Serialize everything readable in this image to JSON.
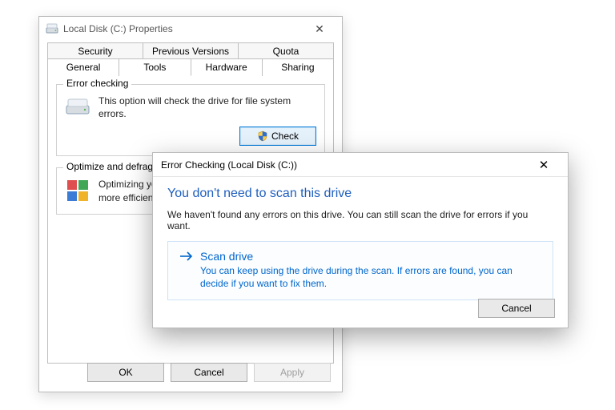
{
  "propWindow": {
    "title": "Local Disk (C:) Properties",
    "tabsBack": [
      "Security",
      "Previous Versions",
      "Quota"
    ],
    "tabsFront": [
      "General",
      "Tools",
      "Hardware",
      "Sharing"
    ],
    "activeTab": "Tools",
    "errorChecking": {
      "legend": "Error checking",
      "text": "This option will check the drive for file system errors.",
      "button": "Check"
    },
    "defrag": {
      "legend": "Optimize and defragment drive",
      "text": "Optimizing your computer's drives can help it run more efficiently."
    },
    "buttons": {
      "ok": "OK",
      "cancel": "Cancel",
      "apply": "Apply"
    }
  },
  "dialog": {
    "title": "Error Checking (Local Disk (C:))",
    "heading": "You don't need to scan this drive",
    "desc": "We haven't found any errors on this drive. You can still scan the drive for errors if you want.",
    "action": {
      "label": "Scan drive",
      "sub": "You can keep using the drive during the scan. If errors are found, you can decide if you want to fix them."
    },
    "cancel": "Cancel"
  }
}
